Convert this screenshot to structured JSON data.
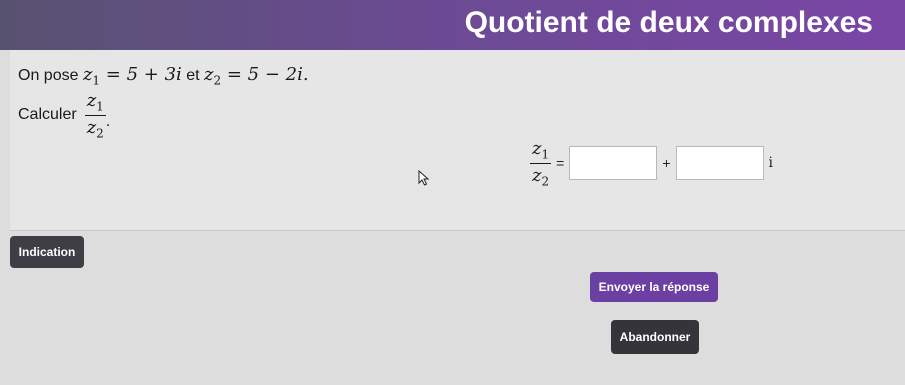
{
  "header": {
    "title": "Quotient de deux complexes"
  },
  "problem": {
    "intro": "On pose",
    "z1_lhs": "z",
    "z1_sub": "1",
    "z1_rhs": " = 5 + 3i",
    "conj": "et",
    "z2_lhs": "z",
    "z2_sub": "2",
    "z2_rhs": " = 5 − 2i.",
    "ask": "Calculer",
    "frac_num": "z",
    "frac_num_sub": "1",
    "frac_den": "z",
    "frac_den_sub": "2",
    "frac_end": "."
  },
  "answer": {
    "num": "z",
    "num_sub": "1",
    "den": "z",
    "den_sub": "2",
    "equals": "=",
    "plus": "+",
    "imag_unit": "i",
    "real_value": "",
    "imag_value": ""
  },
  "buttons": {
    "hint": "Indication",
    "send": "Envoyer la réponse",
    "quit": "Abandonner"
  },
  "colors": {
    "header_start": "#585270",
    "header_end": "#7a46a6",
    "send_button": "#6c3fa2",
    "dark_button": "#3f3e45"
  }
}
